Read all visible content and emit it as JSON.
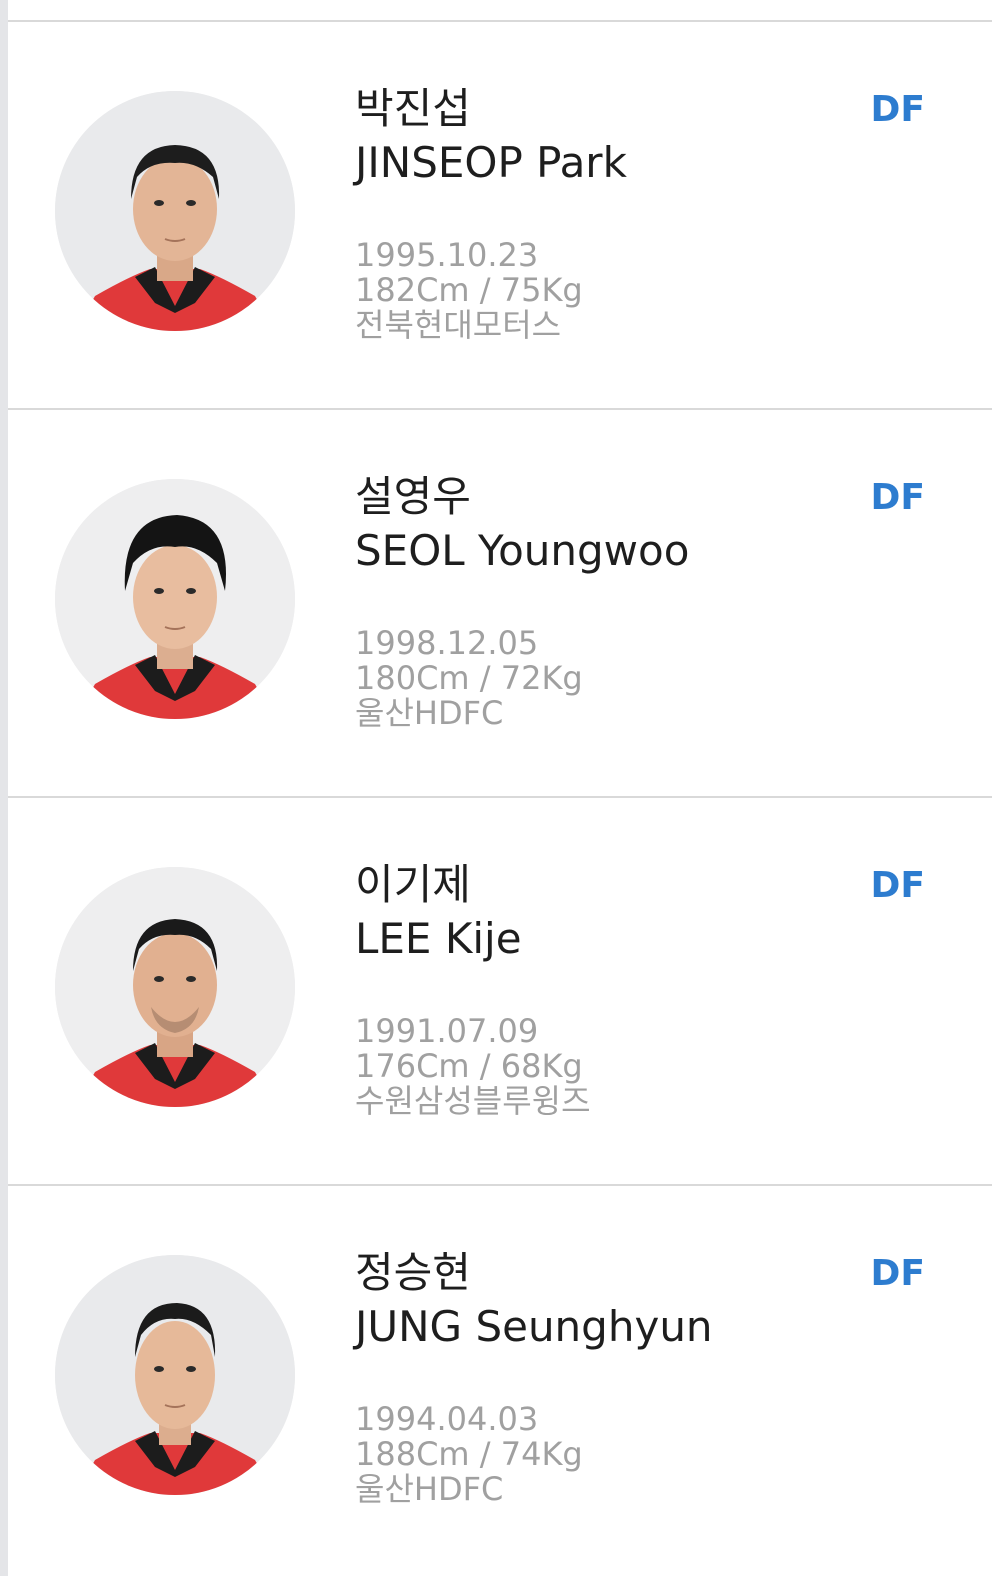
{
  "players": [
    {
      "name_ko": "박진섭",
      "name_en": "JINSEOP Park",
      "position": "DF",
      "birth": "1995.10.23",
      "body": "182Cm / 75Kg",
      "club": "전북현대모터스"
    },
    {
      "name_ko": "설영우",
      "name_en": "SEOL Youngwoo",
      "position": "DF",
      "birth": "1998.12.05",
      "body": "180Cm / 72Kg",
      "club": "울산HDFC"
    },
    {
      "name_ko": "이기제",
      "name_en": "LEE Kije",
      "position": "DF",
      "birth": "1991.07.09",
      "body": "176Cm / 68Kg",
      "club": "수원삼성블루윙즈"
    },
    {
      "name_ko": "정승현",
      "name_en": "JUNG Seunghyun",
      "position": "DF",
      "birth": "1994.04.03",
      "body": "188Cm / 74Kg",
      "club": "울산HDFC"
    }
  ],
  "colors": {
    "position_text": "#2d7ccf",
    "info_text": "#a0a0a0",
    "name_text": "#1e1e1e",
    "divider": "#d9d9d9",
    "jersey": "#e0393a"
  }
}
